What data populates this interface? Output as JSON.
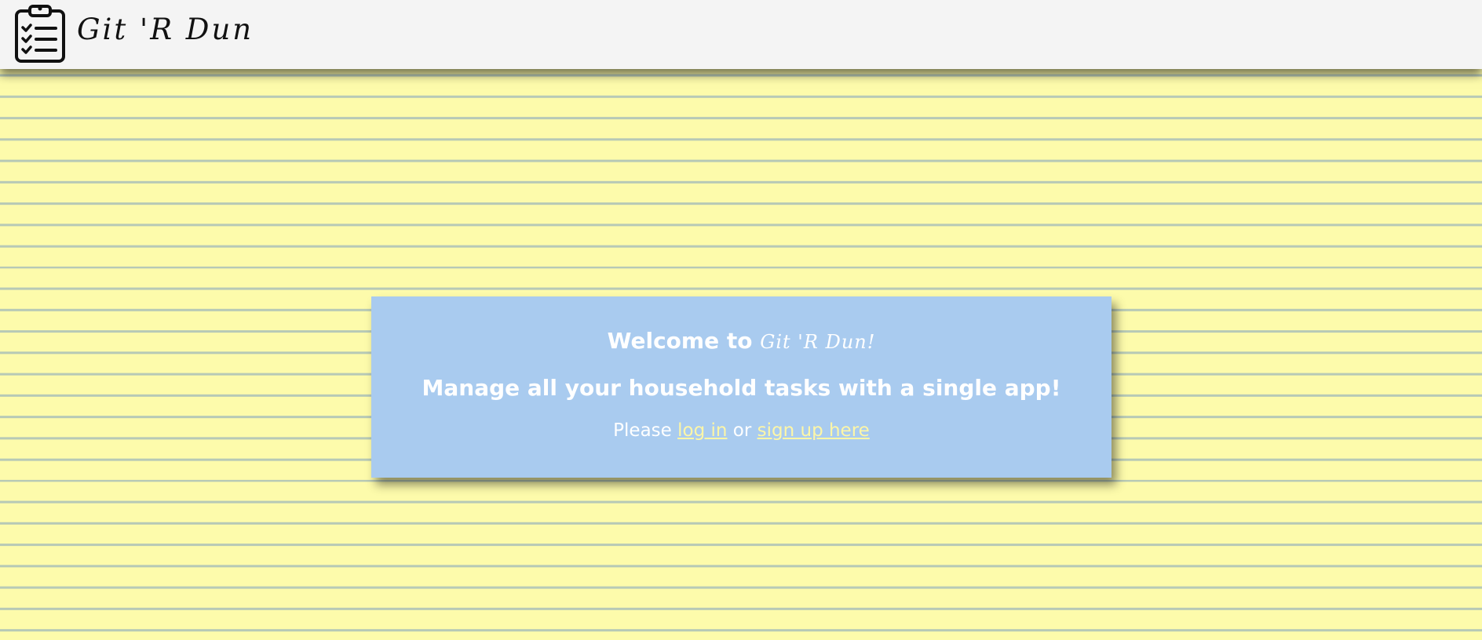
{
  "navbar": {
    "brand_name": "Git 'R Dun",
    "logo_icon": "clipboard-checklist-icon"
  },
  "welcome": {
    "title_prefix": "Welcome to ",
    "title_brand": "Git 'R Dun!",
    "tagline": "Manage all your household tasks with a single app!",
    "cta_prefix": "Please ",
    "login_link": "log in",
    "cta_middle": " or ",
    "signup_link": "sign up here"
  },
  "colors": {
    "navbar_bg": "#f4f4f4",
    "paper_yellow": "#fdfbab",
    "ruled_line": "#b7c9b6",
    "card_bg": "#a9cbef",
    "link_color": "#fdf6a7"
  }
}
